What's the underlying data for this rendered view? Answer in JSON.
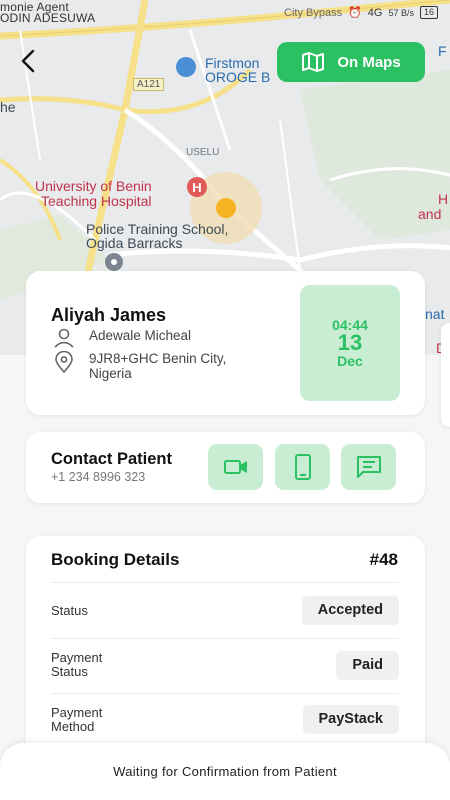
{
  "status_bar": {
    "notif_line1": "monie Agent",
    "notif_line2": "ODIN ADESUWA",
    "map_road": "City Bypass",
    "signal": "4G",
    "speed": "57 B/s",
    "battery": "16"
  },
  "map": {
    "labels": {
      "bank": "Firstmon",
      "bank2": "OROGE B",
      "road_a121": "A121",
      "uselu": "USELU",
      "hospital1": "University of Benin",
      "hospital2": "Teaching Hospital",
      "police1": "Police Training School,",
      "police2": "Ogida Barracks",
      "left_he": "he",
      "right_f": "F",
      "right_h": "H",
      "right_and": "and",
      "right_nat": "nat",
      "right_de": "De"
    }
  },
  "top_actions": {
    "maps_label": "On Maps"
  },
  "patient": {
    "name": "Aliyah James",
    "doctor": "Adewale Micheal",
    "address": "9JR8+GHC Benin City, Nigeria",
    "time": "04:44",
    "day": "13",
    "month": "Dec"
  },
  "contact": {
    "title": "Contact Patient",
    "phone": "+1 234 8996 323"
  },
  "booking": {
    "title": "Booking Details",
    "number": "#48",
    "rows": [
      {
        "label": "Status",
        "value": "Accepted"
      },
      {
        "label": "Payment Status",
        "value": "Paid"
      },
      {
        "label": "Payment Method",
        "value": "PayStack"
      }
    ]
  },
  "footer": {
    "text": "Waiting for Confirmation from Patient"
  },
  "colors": {
    "accent": "#2bc163",
    "accent_light": "#c8edd3"
  }
}
